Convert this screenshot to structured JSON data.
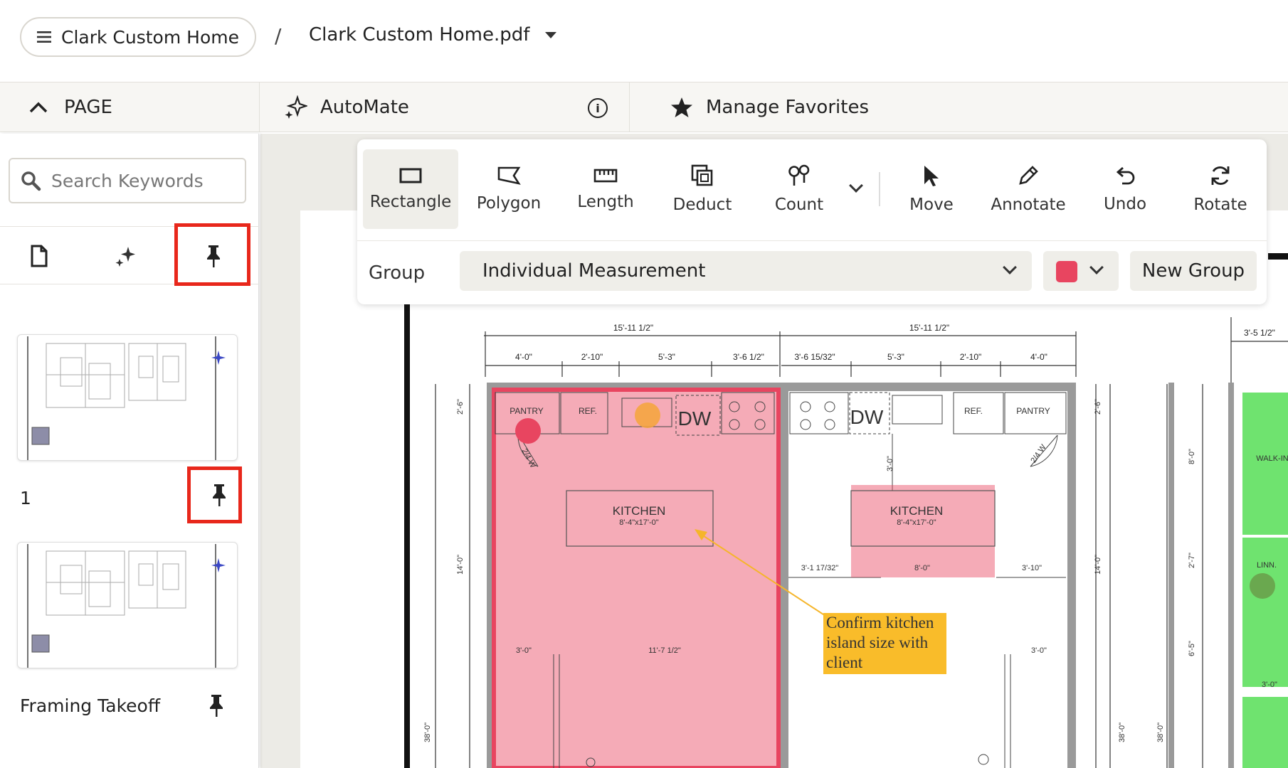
{
  "header": {
    "project_name": "Clark Custom Home",
    "separator": "/",
    "file_name": "Clark Custom Home.pdf"
  },
  "subheader": {
    "page_label": "PAGE",
    "automate_label": "AutoMate",
    "favorites_label": "Manage Favorites"
  },
  "sidebar": {
    "search_placeholder": "Search Keywords",
    "pages": [
      {
        "label": "1",
        "pinned": true
      },
      {
        "label": "Framing Takeoff",
        "pinned": false
      }
    ]
  },
  "toolbar": {
    "tools": [
      "Rectangle",
      "Polygon",
      "Length",
      "Deduct",
      "Count",
      "Move",
      "Annotate",
      "Undo",
      "Rotate"
    ],
    "active_tool": "Rectangle",
    "group_label": "Group",
    "group_value": "Individual Measurement",
    "color": "#e84560",
    "new_group_label": "New Group"
  },
  "drawing": {
    "dims_top_left": [
      "15'-11 1/2\"",
      "4'-0\"",
      "2'-10\"",
      "5'-3\"",
      "3'-6 1/2\""
    ],
    "dims_top_right": [
      "15'-11 1/2\"",
      "3'-6 15/32\"",
      "5'-3\"",
      "2'-10\"",
      "4'-0\""
    ],
    "dim_far_right": "3'-5 1/2\"",
    "rooms": {
      "pantry_left": "PANTRY",
      "ref_left": "REF.",
      "dw_left": "DW",
      "door_left": "2/4 W",
      "kitchen_left": "KITCHEN",
      "kitchen_left_size": "8'-4\"x17'-0\"",
      "dw_right": "DW",
      "ref_right": "REF.",
      "pantry_right": "PANTRY",
      "door_right": "2/4 W",
      "kitchen_right": "KITCHEN",
      "kitchen_right_size": "8'-4\"x17'-0\"",
      "walkin": "WALK-IN",
      "linen": "LINN."
    },
    "side_dims": [
      "2'-6\"",
      "14'-0\"",
      "38'-0\"",
      "2'-6\"",
      "14'-0\"",
      "38'-0\"",
      "38'-0\"",
      "8'-0\"",
      "2'-7\"",
      "6'-5\"",
      "3'-0\""
    ],
    "inner_dims": [
      "3'-0\"",
      "3'-1 17/32\"",
      "8'-0\"",
      "3'-10\"",
      "3'-0\"",
      "11'-7 1/2\"",
      "3'-0\""
    ],
    "annotation": "Confirm kitchen island size with client",
    "colors": {
      "area": "#e84560",
      "count": "#f5a43a",
      "note": "#f9bc2a",
      "green_area": "#5fe05f",
      "highlight": "#e8271b"
    }
  }
}
